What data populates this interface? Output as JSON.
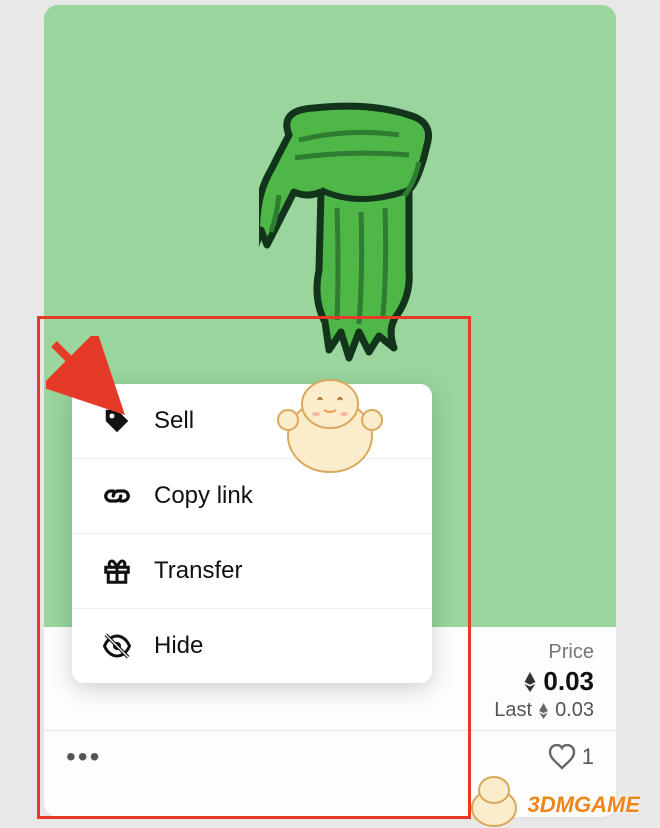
{
  "card": {
    "price_label": "Price",
    "price_value": "0.03",
    "last_label": "Last",
    "last_value": "0.03",
    "like_count": "1"
  },
  "menu": {
    "items": [
      {
        "label": "Sell",
        "icon": "tag-icon"
      },
      {
        "label": "Copy link",
        "icon": "link-icon"
      },
      {
        "label": "Transfer",
        "icon": "gift-icon"
      },
      {
        "label": "Hide",
        "icon": "eye-off-icon"
      }
    ]
  },
  "watermark": {
    "text": "3DMGAME"
  }
}
